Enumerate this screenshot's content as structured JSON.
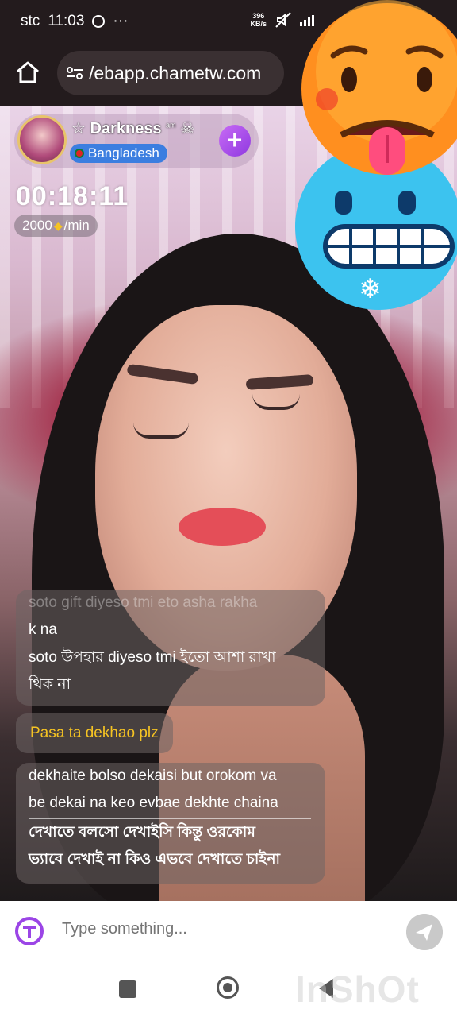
{
  "status_bar": {
    "carrier": "stc",
    "time": "11:03",
    "more": "···",
    "net_speed_value": "396",
    "net_speed_unit": "KB/s"
  },
  "browser": {
    "url": "/ebapp.chametw.com"
  },
  "host": {
    "name": "Darkness",
    "name_small": "am",
    "country": "Bangladesh",
    "follow_label": "+"
  },
  "call": {
    "timer": "00:18:11",
    "rate_value": "2000",
    "rate_unit": "/min"
  },
  "chat": {
    "message1_faded": "soto gift diyeso tmi eto asha rakha",
    "message1_line1": "k na",
    "message1_line2": "soto উপহার diyeso tmi ইতো আশা রাখা",
    "message1_line3": "থিক না",
    "message2": "Pasa ta dekhao plz",
    "message3_line1": "dekhaite bolso dekaisi but orokom va",
    "message3_line2": "be dekai na keo evbae dekhte chaina",
    "message3_line3": "দেখাতে বলসো দেখাইসি কিন্তু ওরকোম",
    "message3_line4": "ভ্যাবে দেখাই না কিও এভবে দেখাতে চাইনা"
  },
  "input": {
    "placeholder": "Type something..."
  },
  "watermark": "InShOt",
  "colors": {
    "follow_button": "#9b45e6",
    "country_pill": "#3b7ee0",
    "highlight_message": "#f5c323"
  }
}
